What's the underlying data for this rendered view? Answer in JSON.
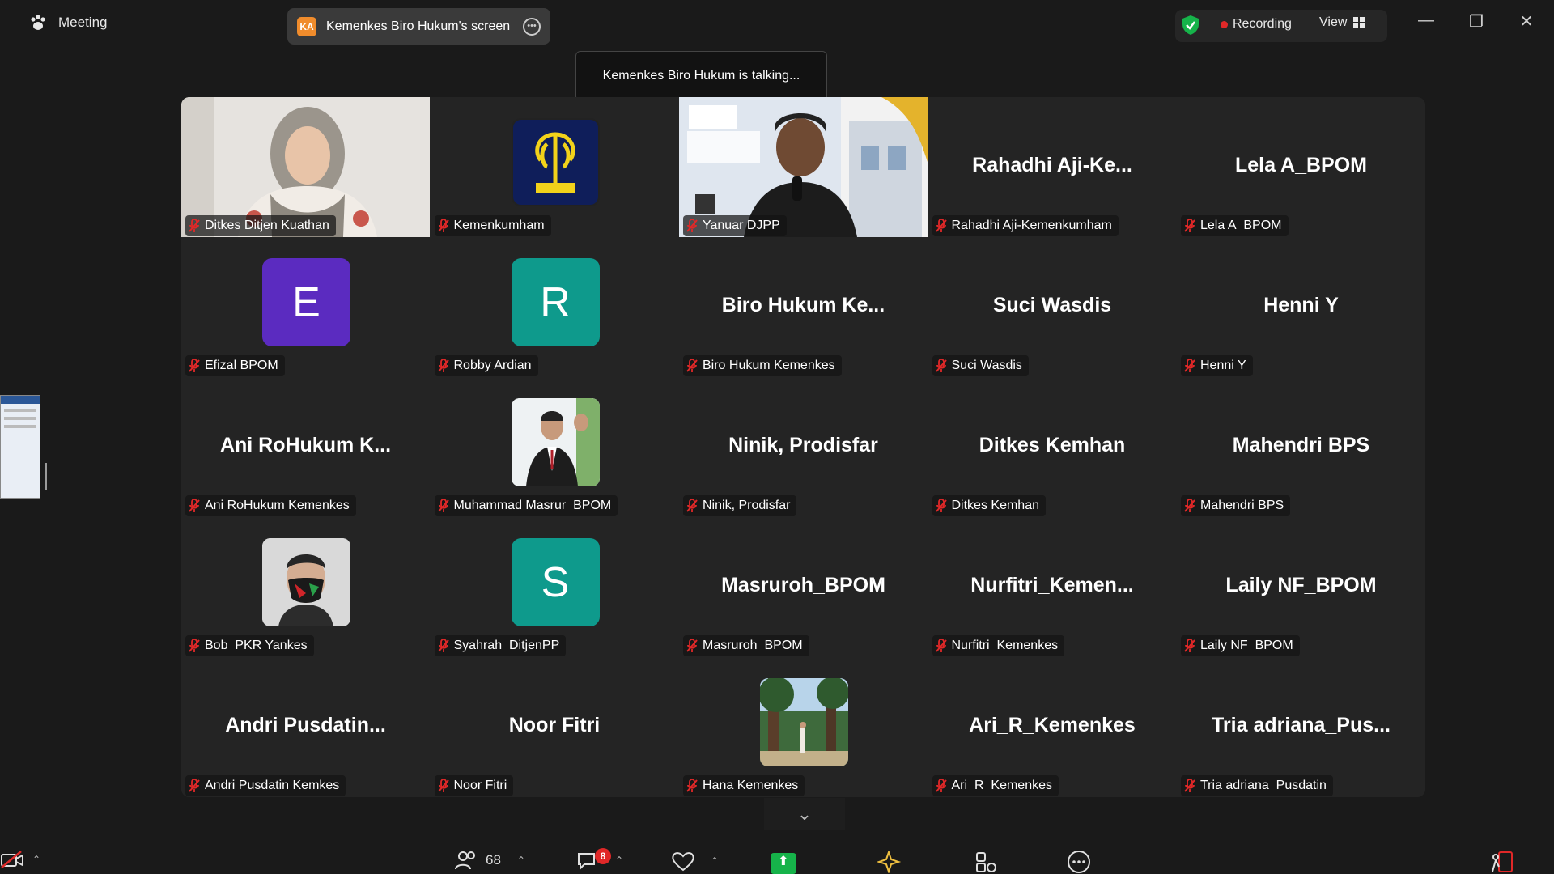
{
  "topbar": {
    "meeting_label": "Meeting",
    "share_chip_badge": "KA",
    "share_chip_label": "Kemenkes Biro Hukum's screen",
    "recording_label": "Recording",
    "view_label": "View",
    "accent_green": "#16b34a",
    "record_color": "#e02828"
  },
  "toast": {
    "text": "Kemenkes Biro Hukum is talking..."
  },
  "grid": {
    "tiles": [
      {
        "label": "Ditkes Ditjen Kuathan",
        "type": "video-woman"
      },
      {
        "label": "Kemenkumham",
        "type": "logo"
      },
      {
        "label": "Yanuar DJPP",
        "type": "video-man"
      },
      {
        "label": "Rahadhi Aji-Kemenkumham",
        "type": "name",
        "big": "Rahadhi  Aji-Ke..."
      },
      {
        "label": "Lela A_BPOM",
        "type": "name",
        "big": "Lela A_BPOM"
      },
      {
        "label": "Efizal BPOM",
        "type": "initial",
        "initial": "E",
        "color": "#5b2bc0"
      },
      {
        "label": "Robby Ardian",
        "type": "initial",
        "initial": "R",
        "color": "#0e9a8c"
      },
      {
        "label": "Biro Hukum Kemenkes",
        "type": "name",
        "big": "Biro Hukum Ke..."
      },
      {
        "label": "Suci Wasdis",
        "type": "name",
        "big": "Suci Wasdis"
      },
      {
        "label": "Henni Y",
        "type": "name",
        "big": "Henni Y"
      },
      {
        "label": "Ani RoHukum Kemenkes",
        "type": "name",
        "big": "Ani RoHukum K..."
      },
      {
        "label": "Muhammad Masrur_BPOM",
        "type": "photo-suit"
      },
      {
        "label": "Ninik, Prodisfar",
        "type": "name",
        "big": "Ninik, Prodisfar"
      },
      {
        "label": "Ditkes Kemhan",
        "type": "name",
        "big": "Ditkes Kemhan"
      },
      {
        "label": "Mahendri BPS",
        "type": "name",
        "big": "Mahendri BPS"
      },
      {
        "label": "Bob_PKR Yankes",
        "type": "photo-mask"
      },
      {
        "label": "Syahrah_DitjenPP",
        "type": "initial",
        "initial": "S",
        "color": "#0e9a8c"
      },
      {
        "label": "Masruroh_BPOM",
        "type": "name",
        "big": "Masruroh_BPOM"
      },
      {
        "label": "Nurfitri_Kemenkes",
        "type": "name",
        "big": "Nurfitri_Kemen..."
      },
      {
        "label": "Laily NF_BPOM",
        "type": "name",
        "big": "Laily NF_BPOM"
      },
      {
        "label": "Andri Pusdatin Kemkes",
        "type": "name",
        "big": "Andri  Pusdatin..."
      },
      {
        "label": "Noor Fitri",
        "type": "name",
        "big": "Noor Fitri"
      },
      {
        "label": "Hana Kemenkes",
        "type": "photo-forest"
      },
      {
        "label": "Ari_R_Kemenkes",
        "type": "name",
        "big": "Ari_R_Kemenkes"
      },
      {
        "label": "Tria adriana_Pusdatin",
        "type": "name",
        "big": "Tria  adriana_Pus..."
      }
    ]
  },
  "bottombar": {
    "participants_count": "68",
    "chat_badge": "8"
  }
}
